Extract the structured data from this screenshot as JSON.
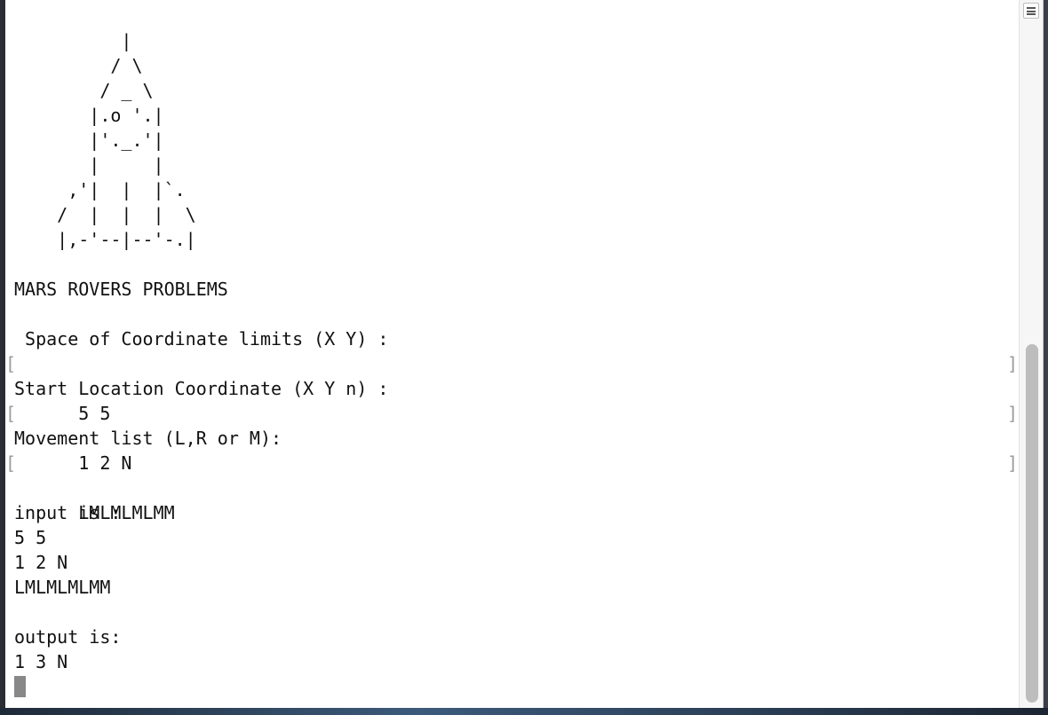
{
  "terminal": {
    "ascii_art": [
      "          |",
      "         / \\",
      "        / _ \\",
      "       |.o '.|",
      "       |'._.'|",
      "       |     |",
      "     ,'|  |  |`.",
      "    /  |  |  |  \\",
      "    |,-'--|--'-.|"
    ],
    "title": "MARS ROVERS PROBLEMS",
    "prompt_limits": " Space of Coordinate limits (X Y) :",
    "value_limits": "5 5",
    "prompt_start": "Start Location Coordinate (X Y n) :",
    "value_start": "1 2 N",
    "prompt_moves": "Movement list (L,R or M):",
    "value_moves": "LMLMLMLMM",
    "input_header": "input is :",
    "input_lines": [
      "5 5",
      "1 2 N",
      "LMLMLMLMM"
    ],
    "output_header": "output is:",
    "output_value": "1 3 N",
    "bracket_open": "[",
    "bracket_close": "]"
  },
  "scrollbar": {
    "position": 0.98
  }
}
